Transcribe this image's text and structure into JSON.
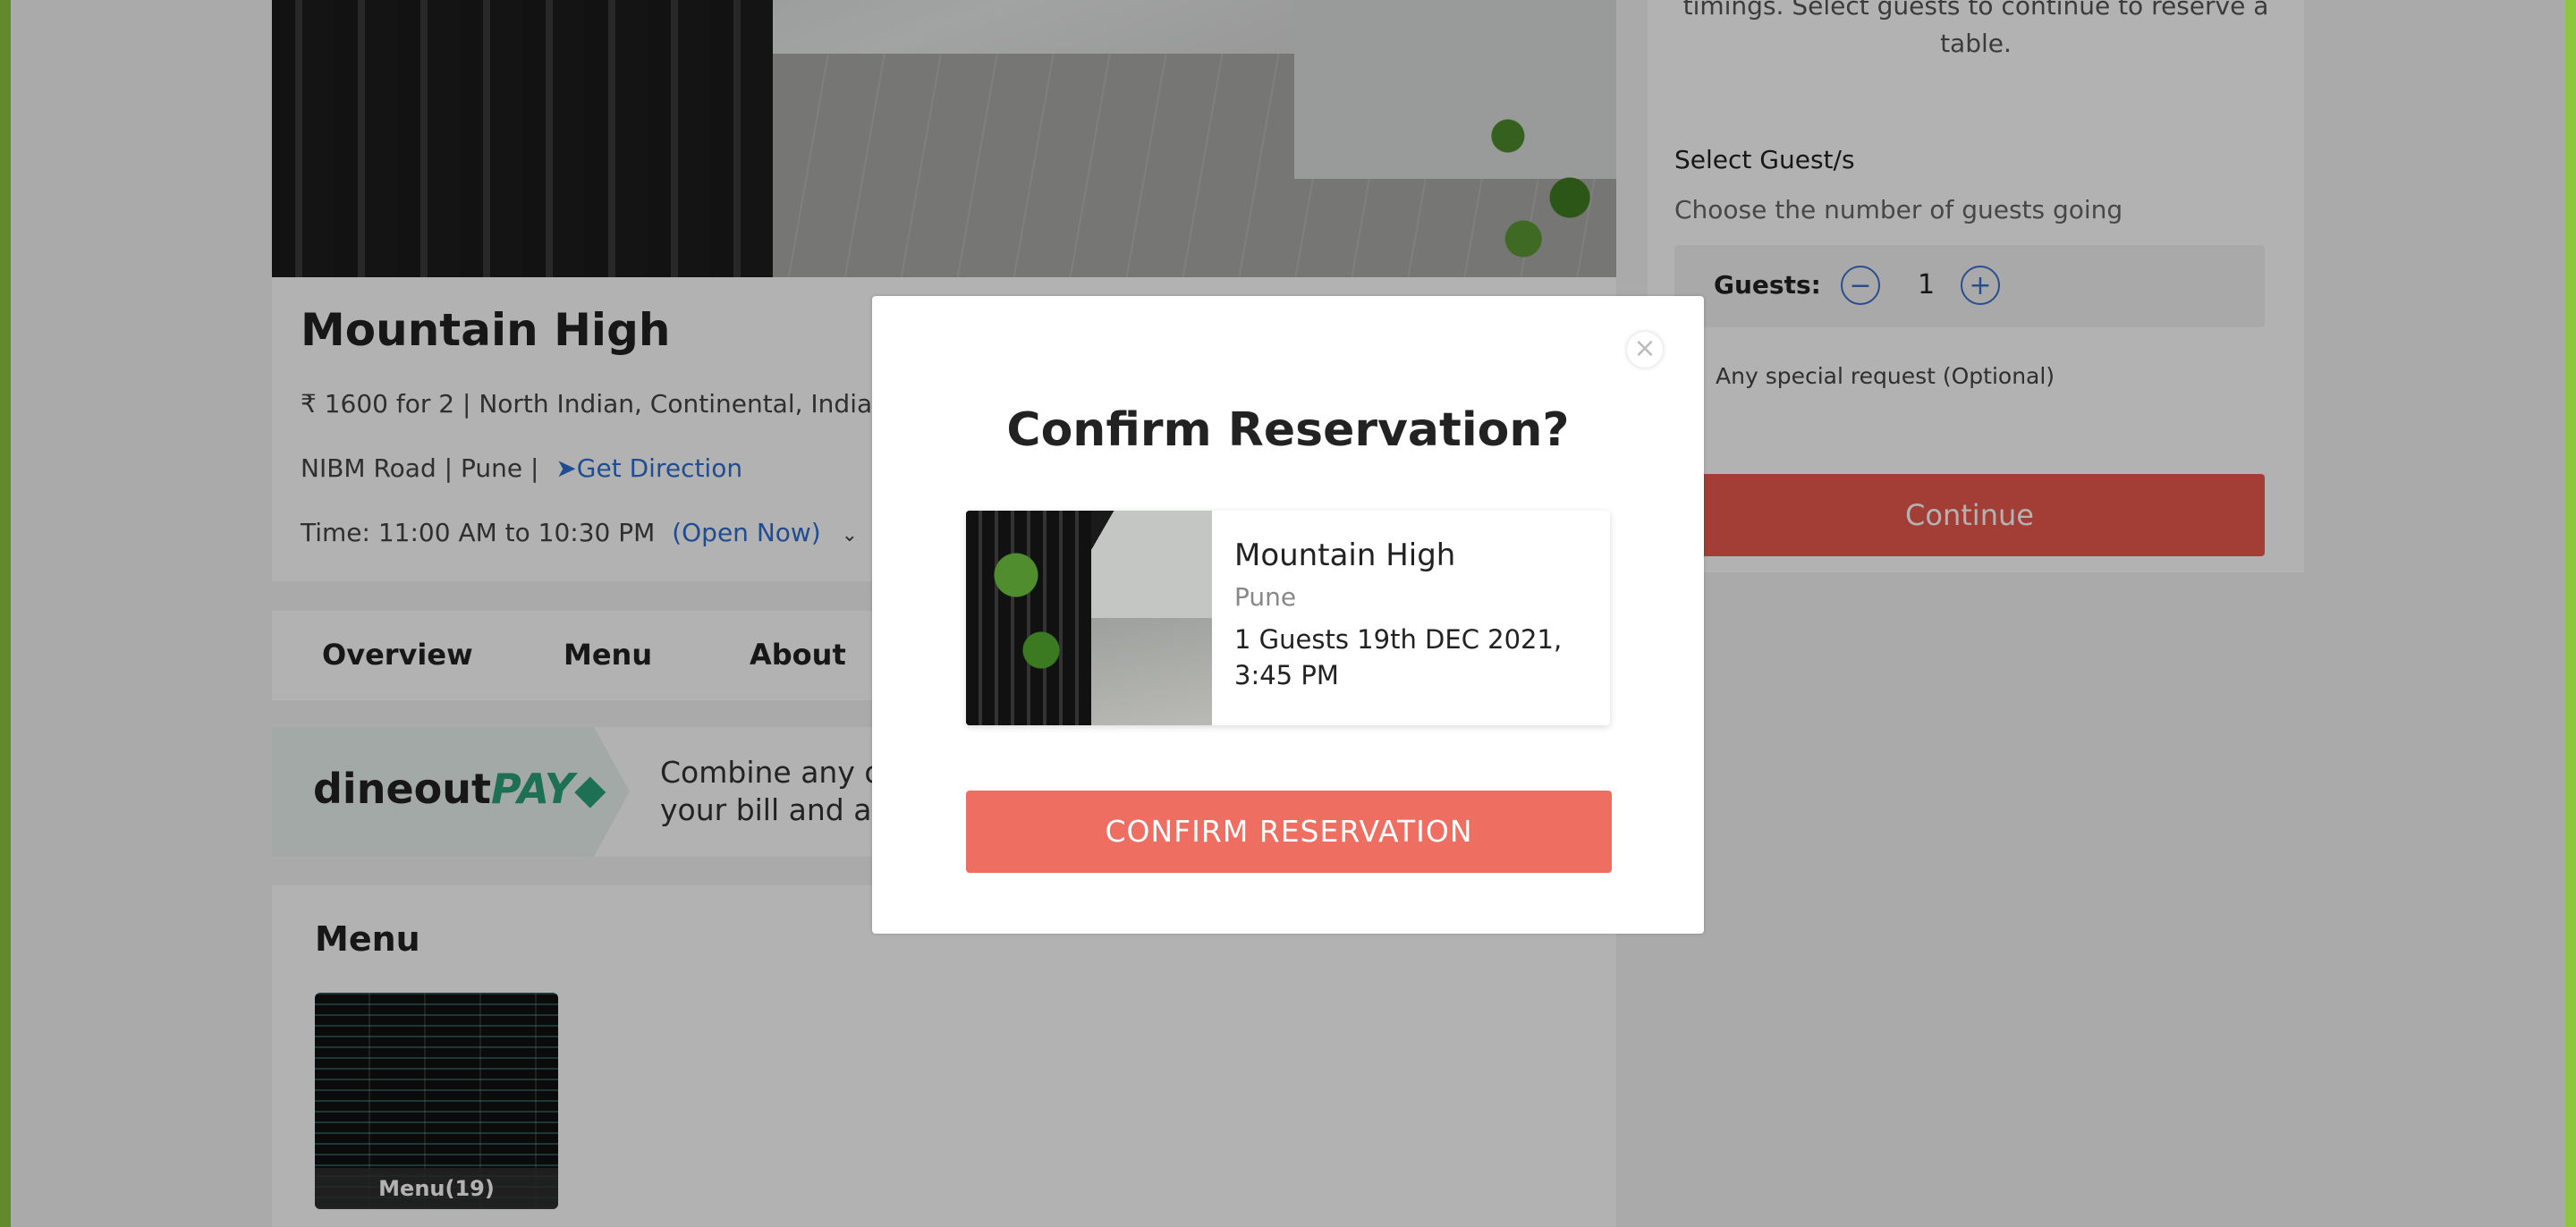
{
  "restaurant": {
    "name": "Mountain High",
    "meta": "₹ 1600 for 2 | North Indian, Continental, Indian",
    "location": "NIBM Road | Pune |",
    "direction_label": "Get Direction",
    "time": "Time: 11:00 AM to 10:30 PM",
    "open_status": "(Open Now)"
  },
  "tabs": [
    {
      "label": "Overview"
    },
    {
      "label": "Menu"
    },
    {
      "label": "About"
    }
  ],
  "pay_banner": {
    "logo_main": "dineout",
    "logo_pay": "PAY",
    "text": "Combine any o your bill and al"
  },
  "menu_section": {
    "title": "Menu",
    "thumb_caption": "Menu(19)"
  },
  "booking": {
    "note": "timings. Select guests to continue to reserve a table.",
    "guest_heading": "Select Guest/s",
    "guest_sub": "Choose the number of guests going",
    "guest_label": "Guests:",
    "guest_count": "1",
    "minus_symbol": "−",
    "plus_symbol": "+",
    "special_request": "Any special request (Optional)",
    "continue_label": "Continue"
  },
  "modal": {
    "close_symbol": "×",
    "title": "Confirm Reservation?",
    "card": {
      "name": "Mountain High",
      "city": "Pune",
      "details": "1 Guests 19th DEC 2021, 3:45 PM"
    },
    "confirm_label": "CONFIRM RESERVATION"
  },
  "colors": {
    "accent_green": "#8dc63f",
    "link_blue": "#2e6fd0",
    "continue_red": "#e8594e",
    "confirm_red": "#ee6e61"
  }
}
